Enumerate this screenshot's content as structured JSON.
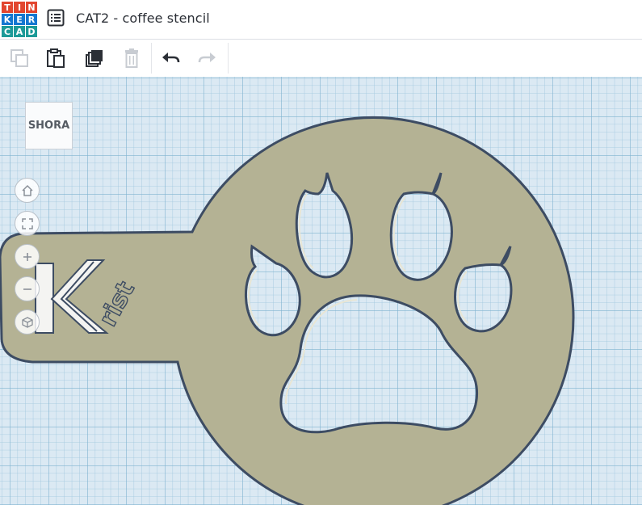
{
  "app": {
    "logo_letters": [
      "T",
      "I",
      "N",
      "K",
      "E",
      "R",
      "C",
      "A",
      "D"
    ],
    "logo_colors": [
      "#e2462f",
      "#e2462f",
      "#e2462f",
      "#1477d1",
      "#1477d1",
      "#1477d1",
      "#1d9a98",
      "#1d9a98",
      "#1d9a98"
    ],
    "design_title": "CAT2 - coffee stencil"
  },
  "toolbar": {
    "buttons": [
      {
        "name": "copy",
        "icon": "copy-icon",
        "enabled": false
      },
      {
        "name": "paste",
        "icon": "paste-icon",
        "enabled": true
      },
      {
        "name": "duplicate",
        "icon": "duplicate-icon",
        "enabled": true
      },
      {
        "name": "delete",
        "icon": "trash-icon",
        "enabled": false
      },
      {
        "name": "undo",
        "icon": "undo-icon",
        "enabled": true
      },
      {
        "name": "redo",
        "icon": "redo-icon",
        "enabled": false
      }
    ]
  },
  "viewcube": {
    "label": "SHORA"
  },
  "nav_controls": [
    "home-icon",
    "fit-view-icon",
    "zoom-in-icon",
    "zoom-out-icon",
    "perspective-icon"
  ],
  "model": {
    "text": "Krist",
    "stencil_color": "#b4b294",
    "edge_color": "#3d4c63"
  },
  "colors": {
    "grid_bg": "#dbe9f3",
    "grid_minor": "#9dc6dd",
    "grid_major": "#7fb3d0"
  }
}
